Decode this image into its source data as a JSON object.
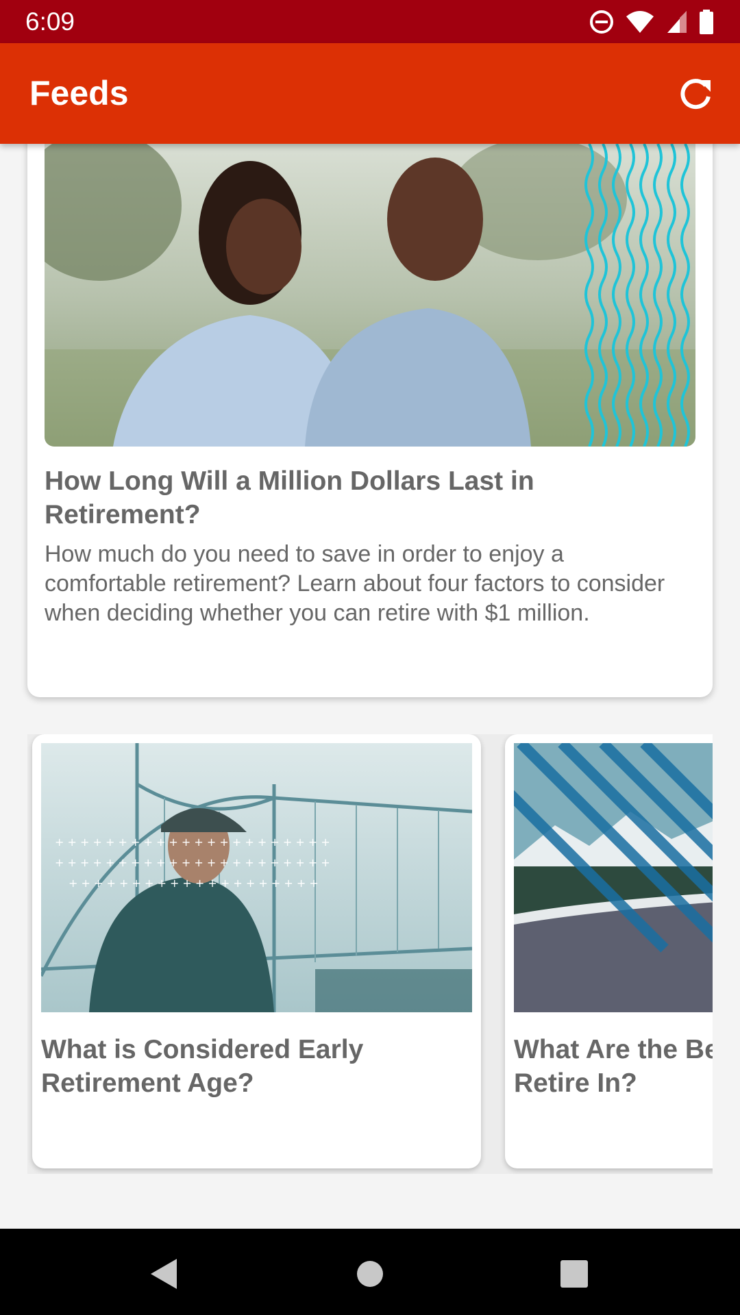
{
  "status_bar": {
    "time": "6:09"
  },
  "app_bar": {
    "title": "Feeds",
    "refresh_icon": "refresh-icon"
  },
  "featured": {
    "title": "How Long Will a Million Dollars Last in Retirement?",
    "description": "How much do you need to save in order to enjoy a comfortable retirement? Learn about four factors to consider when deciding whether you can retire with $1 million."
  },
  "carousel": [
    {
      "title_line1": "What is Considered Early",
      "title_line2": "Retirement Age?"
    },
    {
      "title_line1": "What Are the Be",
      "title_line2": "Retire In?"
    }
  ],
  "colors": {
    "status_bar": "#a1000f",
    "app_bar": "#dc3005",
    "accent_cyan": "#1fc4d8"
  }
}
